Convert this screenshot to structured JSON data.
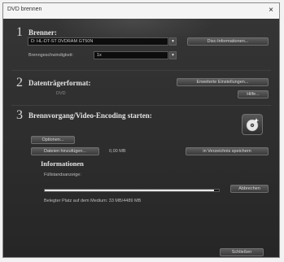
{
  "window": {
    "title": "DVD brennen",
    "close_glyph": "×"
  },
  "section1": {
    "number": "1",
    "heading": "Brenner:",
    "drive_value": "D: HL-DT-ST DVDRAM GT50N",
    "drive_info_button": "Disc-Informationen...",
    "speed_label": "Brenngeschwindigkeit:",
    "speed_value": "1x"
  },
  "section2": {
    "number": "2",
    "heading": "Datenträgerformat:",
    "format_value": "DVD",
    "advanced_button": "Erweiterte Einstellungen...",
    "help_button": "Hilfe..."
  },
  "section3": {
    "number": "3",
    "heading": "Brennvorgang/Video-Encoding starten:",
    "options_button": "Optionen...",
    "add_files_button": "Dateien hinzufügen...",
    "size_value": "0,00 MB",
    "save_to_disk_button": "in Verzeichnis speichern",
    "burn_icon": "burn-disc-icon"
  },
  "info": {
    "heading": "Informationen",
    "status_label": "Füllstandsanzeige:",
    "progress_fraction": 0.97,
    "cancel_button": "Abbrechen",
    "space_text": "Belegter Platz auf dem Medium: 33 MB/4489 MB"
  },
  "footer": {
    "close_button": "Schließen"
  }
}
